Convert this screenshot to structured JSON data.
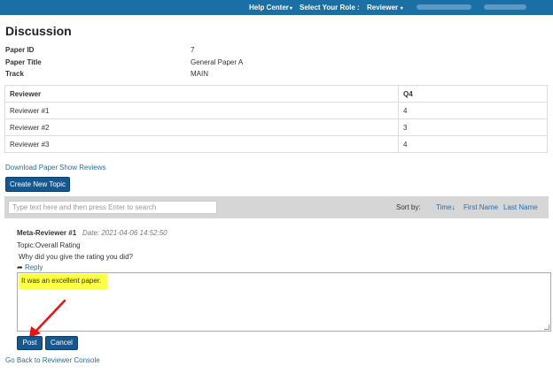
{
  "topbar": {
    "help_center": "Help Center",
    "select_role": "Select Your Role :",
    "role": "Reviewer",
    "bg_color": "#1a6fa5"
  },
  "page": {
    "title": "Discussion"
  },
  "info": {
    "paper_id_label": "Paper ID",
    "paper_id": "7",
    "paper_title_label": "Paper Title",
    "paper_title": "General Paper A",
    "track_label": "Track",
    "track": "MAIN"
  },
  "reviews": {
    "headers": [
      "Reviewer",
      "Q4"
    ],
    "rows": [
      {
        "reviewer": "Reviewer #1",
        "q4": "4"
      },
      {
        "reviewer": "Reviewer #2",
        "q4": "3"
      },
      {
        "reviewer": "Reviewer #3",
        "q4": "4"
      }
    ]
  },
  "links": {
    "download_paper": "Download Paper",
    "show_reviews": "Show Reviews",
    "back": "Go Back to Reviewer Console"
  },
  "buttons": {
    "create_topic": "Create New Topic",
    "post": "Post",
    "cancel": "Cancel",
    "color": "#15588f"
  },
  "search": {
    "placeholder": "Type text here and then press Enter to search"
  },
  "sort": {
    "label": "Sort by:",
    "time": "Time",
    "first_name": "First Name",
    "last_name": "Last Name"
  },
  "comment": {
    "author": "Meta-Reviewer #1",
    "date": "Date: 2021-04-06 14:52:50",
    "topic": "Topic:Overall Rating",
    "question": "Why did you give the rating you did?",
    "reply_label": "Reply"
  },
  "editor": {
    "text": "It was an excellent paper.",
    "highlight_color": "#ffff44"
  },
  "annotation": {
    "arrow_color": "#e11"
  }
}
